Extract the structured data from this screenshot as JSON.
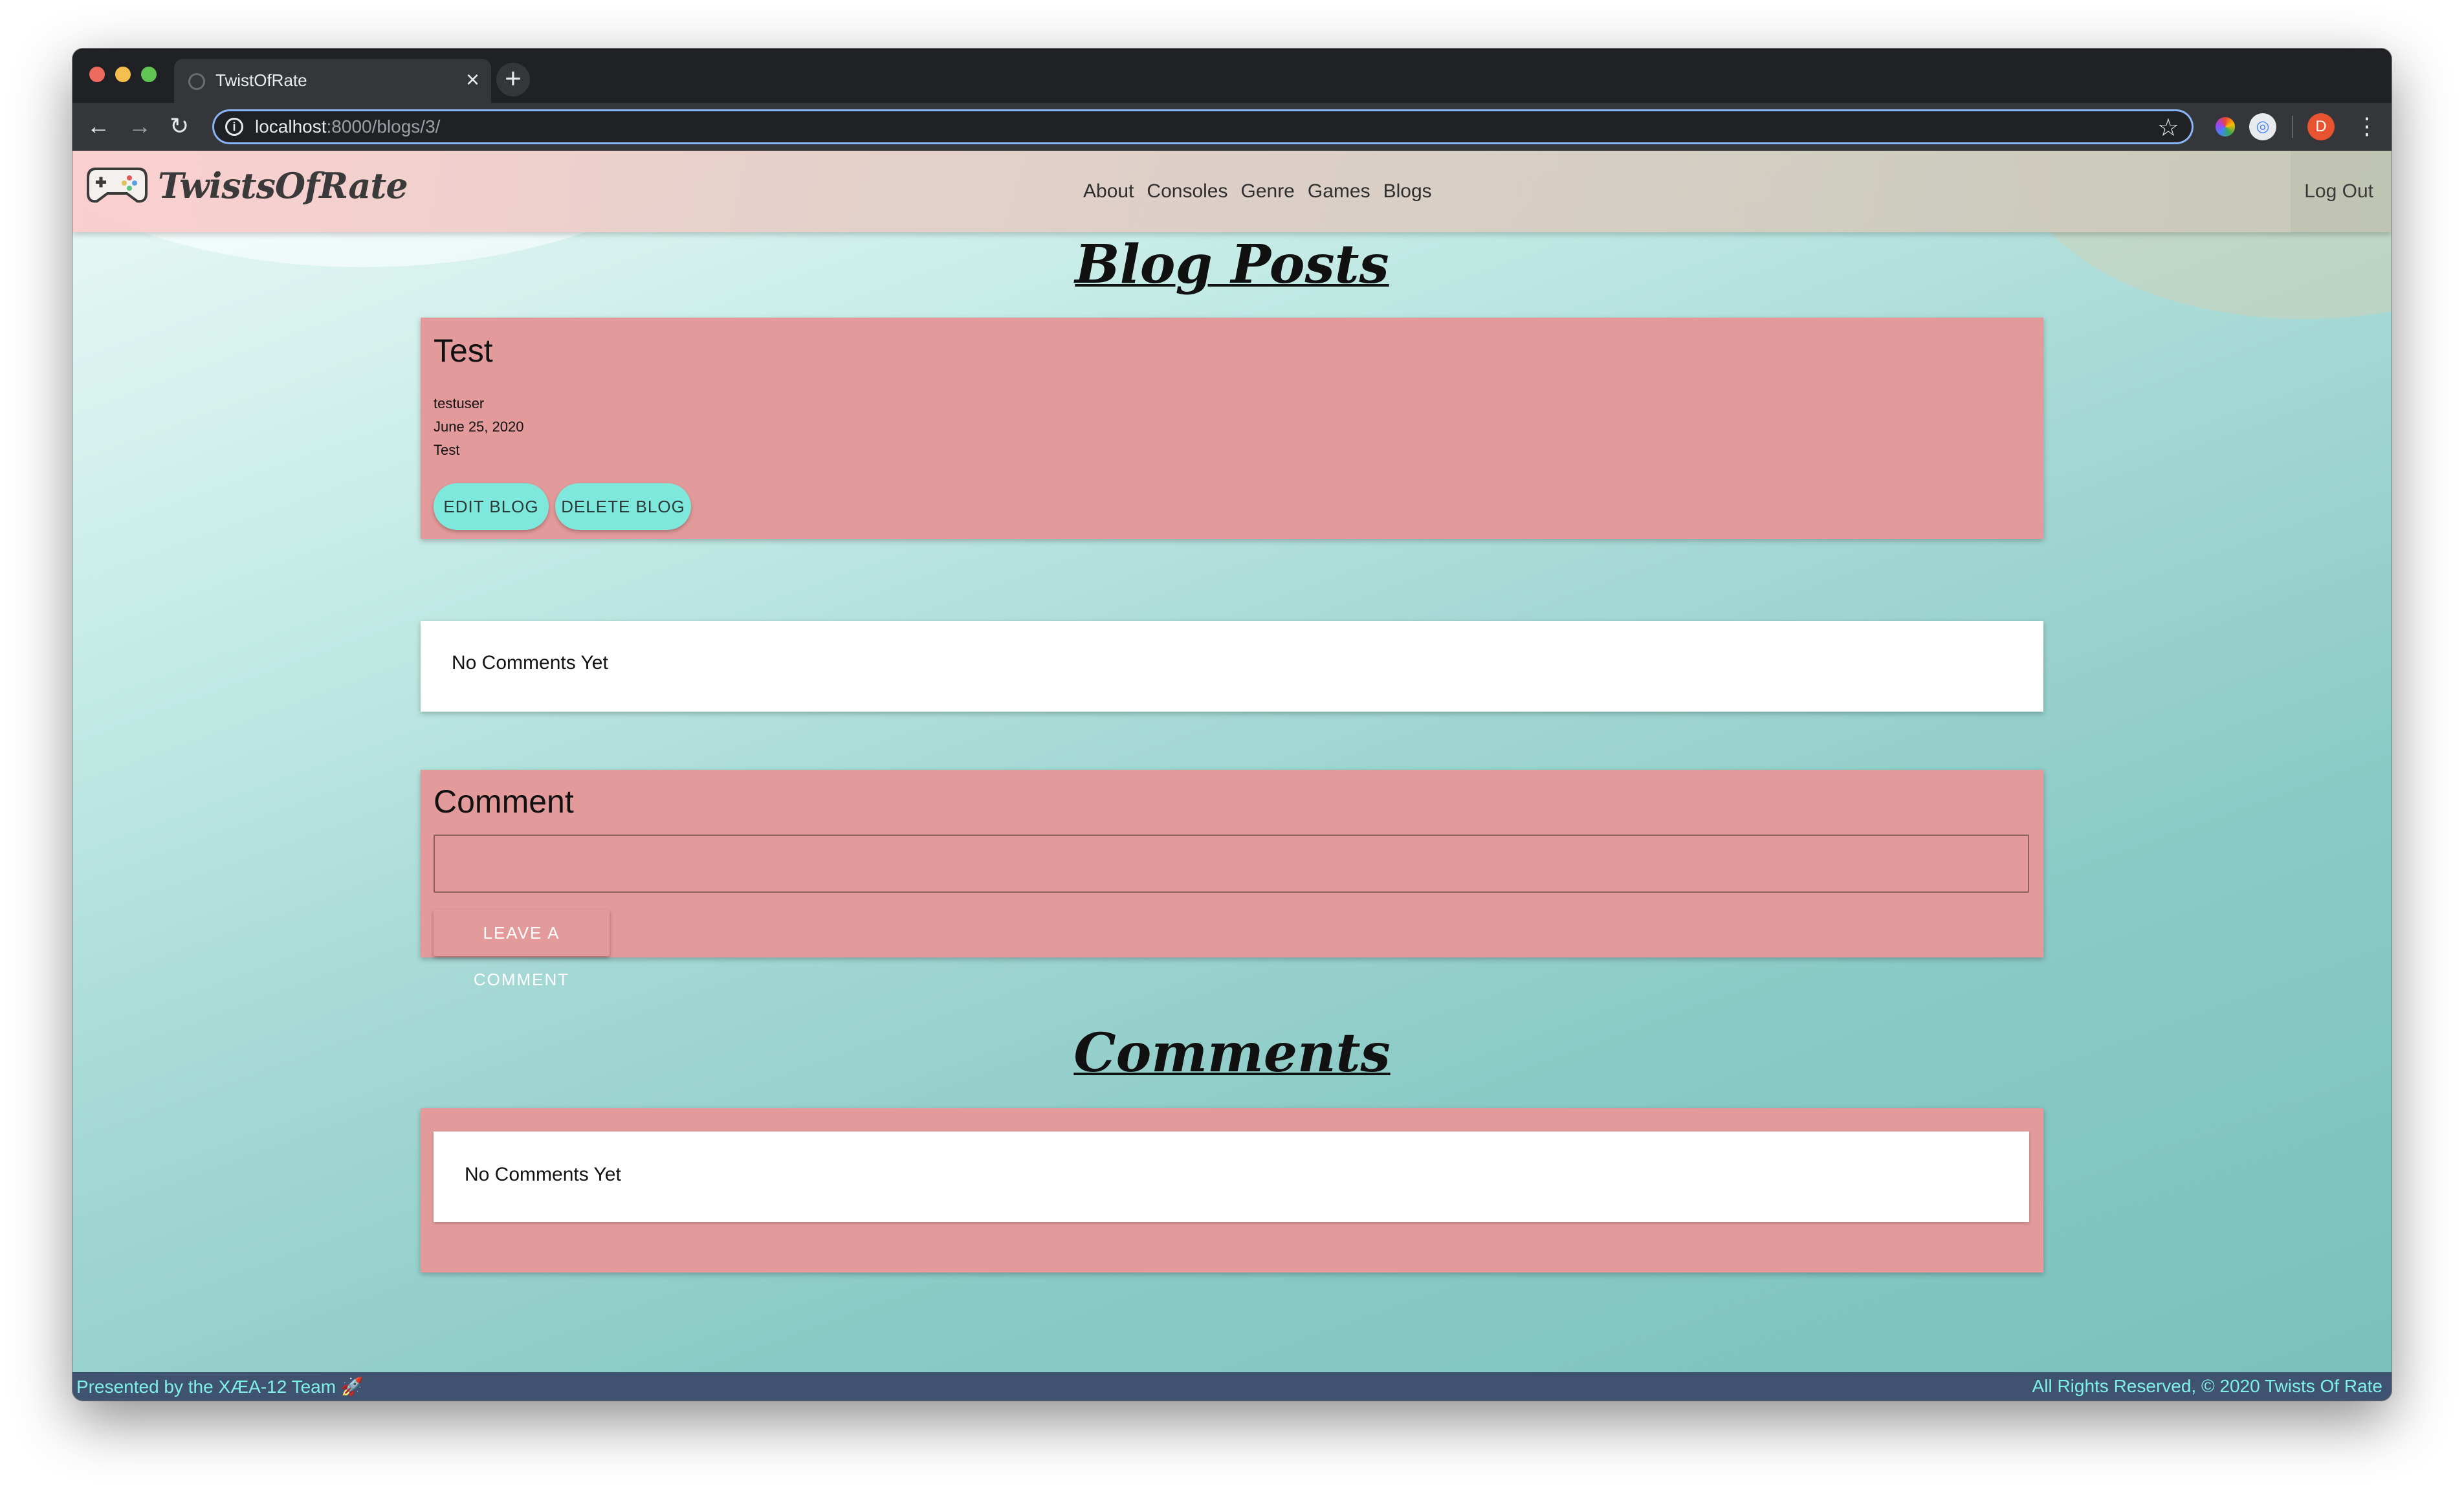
{
  "browser": {
    "tab_title": "TwistOfRate",
    "tab_close": "×",
    "new_tab": "+",
    "url_host": "localhost",
    "url_path": ":8000/blogs/3/",
    "back_icon": "←",
    "forward_icon": "→",
    "reload_icon": "↻",
    "info_icon": "i",
    "star_icon": "☆",
    "profile_initial": "D",
    "menu_icon": "⋮"
  },
  "site": {
    "brand": "TwistsOfRate",
    "nav": [
      "About",
      "Consoles",
      "Genre",
      "Games",
      "Blogs"
    ],
    "logout": "Log Out"
  },
  "page": {
    "title": "Blog Posts",
    "comments_title": "Comments"
  },
  "blog": {
    "title": "Test",
    "author": "testuser",
    "date": "June 25, 2020",
    "body": "Test",
    "edit_label": "EDIT BLOG",
    "delete_label": "DELETE BLOG"
  },
  "comments_preview": {
    "empty_text": "No Comments Yet"
  },
  "comment_form": {
    "label": "Comment",
    "value": "",
    "submit_label": "LEAVE A COMMENT"
  },
  "comments_list": {
    "empty_text": "No Comments Yet"
  },
  "footer": {
    "left": "Presented by the XÆA-12 Team 🚀",
    "right": "All Rights Reserved, © 2020 Twists Of Rate"
  },
  "colors": {
    "card_pink": "#e39a9a",
    "button_teal": "#7fe8dc",
    "footer_bg": "#3f5270",
    "footer_text": "#7ff0e6"
  }
}
